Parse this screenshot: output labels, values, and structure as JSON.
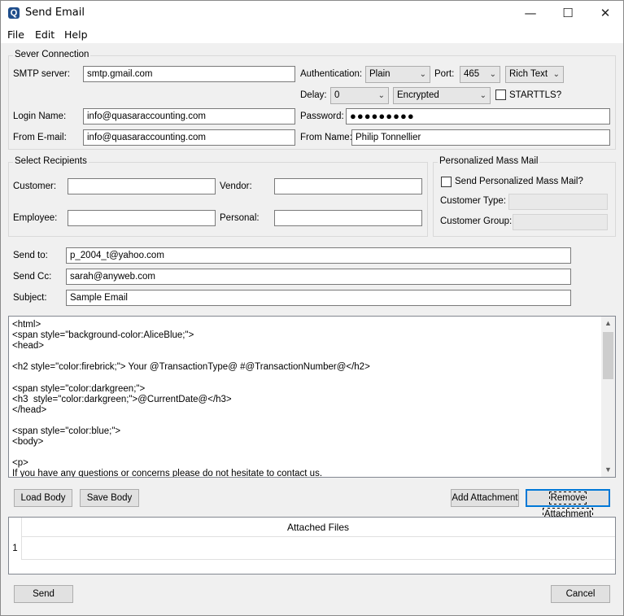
{
  "window": {
    "title": "Send Email",
    "minimize": "—",
    "maximize": "☐",
    "close": "✕"
  },
  "menu": [
    "File",
    "Edit",
    "Help"
  ],
  "server": {
    "group_title": "Sever Connection",
    "smtp_label": "SMTP server:",
    "smtp_value": "smtp.gmail.com",
    "auth_label": "Authentication:",
    "auth_value": "Plain",
    "port_label": "Port:",
    "port_value": "465",
    "format_value": "Rich Text",
    "delay_label": "Delay:",
    "delay_value": "0",
    "encryption_value": "Encrypted",
    "starttls_label": "STARTTLS?",
    "starttls_checked": false,
    "login_label": "Login Name:",
    "login_value": "info@quasaraccounting.com",
    "password_label": "Password:",
    "password_value": "●●●●●●●●●",
    "from_email_label": "From E-mail:",
    "from_email_value": "info@quasaraccounting.com",
    "from_name_label": "From Name:",
    "from_name_value": "Philip Tonnellier"
  },
  "recipients": {
    "group_title": "Select Recipients",
    "customer_label": "Customer:",
    "customer_value": "",
    "vendor_label": "Vendor:",
    "vendor_value": "",
    "employee_label": "Employee:",
    "employee_value": "",
    "personal_label": "Personal:",
    "personal_value": ""
  },
  "mass_mail": {
    "group_title": "Personalized Mass Mail",
    "send_label": "Send Personalized Mass Mail?",
    "send_checked": false,
    "customer_type_label": "Customer Type:",
    "customer_group_label": "Customer Group:"
  },
  "message": {
    "send_to_label": "Send to:",
    "send_to_value": "p_2004_t@yahoo.com",
    "send_cc_label": "Send Cc:",
    "send_cc_value": "sarah@anyweb.com",
    "subject_label": "Subject:",
    "subject_value": "Sample Email"
  },
  "body_lines": [
    "<html>",
    "<span style=\"background-color:AliceBlue;\">",
    "<head>",
    "",
    "<h2 style=\"color:firebrick;\"> Your @TransactionType@ #@TransactionNumber@</h2>",
    "",
    "<span style=\"color:darkgreen;\">",
    "<h3  style=\"color:darkgreen;\">@CurrentDate@</h3>",
    "</head>",
    "",
    "<span style=\"color:blue;\">",
    "<body>",
    "",
    "<p>",
    "If you have any questions or concerns please do not hesitate to contact us."
  ],
  "buttons": {
    "load_body": "Load Body",
    "save_body": "Save Body",
    "add_attachment": "Add Attachment",
    "remove_attachment": "Remove Attachment",
    "send": "Send",
    "cancel": "Cancel"
  },
  "attached": {
    "header": "Attached Files",
    "rows": [
      "1"
    ]
  }
}
